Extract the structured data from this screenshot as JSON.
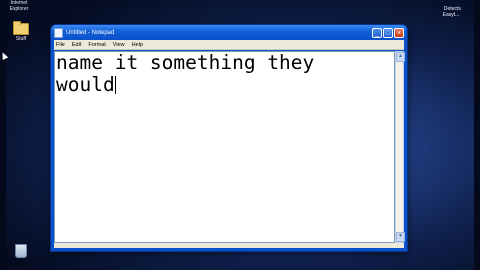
{
  "desktop": {
    "top_icon_label": "Internet\nExplorer",
    "folder_icon_label": "Stuff",
    "right_top_fragment": "Detects\nEasyt..."
  },
  "window": {
    "title": "Untitled - Notepad",
    "menu": [
      "File",
      "Edit",
      "Format",
      "View",
      "Help"
    ],
    "buttons": {
      "minimize": "_",
      "maximize": "□",
      "close": "×"
    },
    "content": "name it something they\nwould"
  }
}
